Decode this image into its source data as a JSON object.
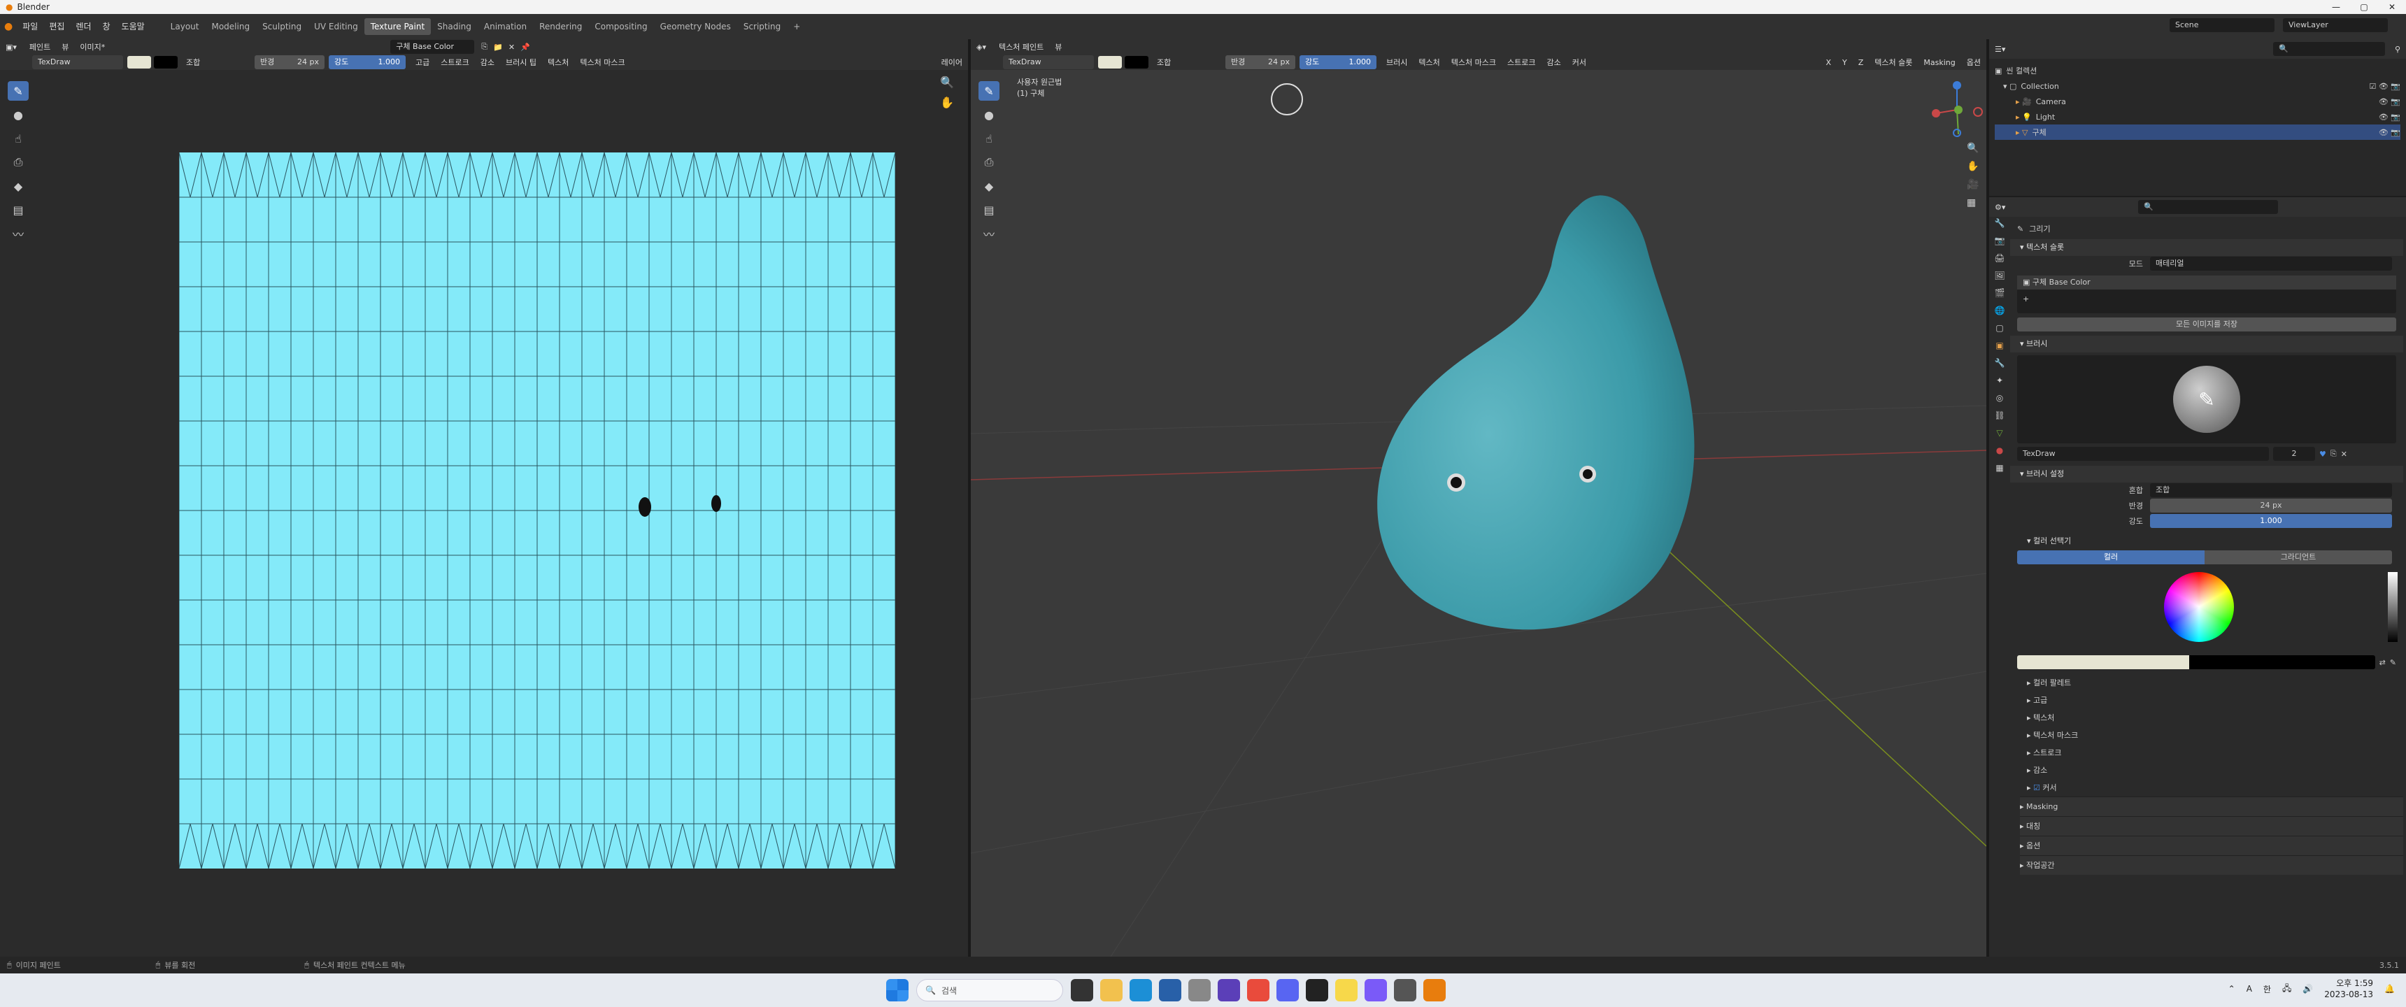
{
  "app": {
    "title": "Blender",
    "version": "3.5.1"
  },
  "menu": [
    "파일",
    "편집",
    "렌더",
    "창",
    "도움말"
  ],
  "workspaces": [
    "Layout",
    "Modeling",
    "Sculpting",
    "UV Editing",
    "Texture Paint",
    "Shading",
    "Animation",
    "Rendering",
    "Compositing",
    "Geometry Nodes",
    "Scripting"
  ],
  "active_workspace": "Texture Paint",
  "scene": {
    "name": "Scene",
    "view_layer": "ViewLayer"
  },
  "image_editor": {
    "mode": "페인트",
    "menus": [
      "뷰",
      "이미지*"
    ],
    "image_name": "구체 Base Color",
    "brush": "TexDraw",
    "blend": "조합",
    "radius_label": "반경",
    "radius_value": "24 px",
    "strength_label": "강도",
    "strength_value": "1.000",
    "dropdowns": [
      "고급",
      "스트로크",
      "감소",
      "브러시 팁",
      "텍스처",
      "텍스처 마스크"
    ],
    "right_label": "레이어"
  },
  "viewport": {
    "mode": "텍스처 페인트",
    "menus": [
      "뷰"
    ],
    "brush": "TexDraw",
    "blend": "조합",
    "radius_label": "반경",
    "radius_value": "24 px",
    "strength_label": "강도",
    "strength_value": "1.000",
    "dropdowns": [
      "브러시",
      "텍스처",
      "텍스처 마스크",
      "스트로크",
      "감소",
      "커서"
    ],
    "right_dropdowns": [
      "텍스처 슬롯",
      "Masking",
      "옵션"
    ],
    "axes": [
      "X",
      "Y",
      "Z"
    ],
    "overlay_line1": "사용자 원근법",
    "overlay_line2": "(1) 구체"
  },
  "outliner": {
    "root": "씬 컬렉션",
    "items": [
      {
        "name": "Collection",
        "selected": false
      },
      {
        "name": "Camera",
        "selected": false
      },
      {
        "name": "Light",
        "selected": false
      },
      {
        "name": "구체",
        "selected": true
      }
    ]
  },
  "properties": {
    "context": "그리기",
    "texture_slots_label": "텍스처 슬롯",
    "mode_label": "모드",
    "mode_value": "매테리얼",
    "slot_item": "구체 Base Color",
    "save_all_images": "모든 이미지를 저장",
    "brush_panel": "브러시",
    "brush_name": "TexDraw",
    "brush_users": "2",
    "brush_settings_panel": "브러시 설정",
    "blend_label": "혼합",
    "blend_value": "조합",
    "radius_label": "반경",
    "radius_value": "24 px",
    "strength_label": "강도",
    "strength_value": "1.000",
    "color_picker_panel": "컬러 선택기",
    "color_tabs": [
      "컬러",
      "그라디언트"
    ],
    "subpanels": [
      "컬러 팔레트",
      "고급",
      "텍스처",
      "텍스처 마스크",
      "스트로크",
      "감소",
      "커서"
    ],
    "bottom_panels": [
      "Masking",
      "대칭",
      "옵션",
      "작업공간"
    ],
    "primary_color": "#e6e5d3",
    "secondary_color": "#000000"
  },
  "status": {
    "left": "이미지 페인트",
    "middle": "뷰를 회전",
    "right": "텍스처 페인트 컨텍스트 메뉴"
  },
  "taskbar": {
    "search_placeholder": "검색",
    "time": "오후 1:59",
    "date": "2023-08-13",
    "tray": [
      "A",
      "한"
    ]
  },
  "colors": {
    "accent_blue": "#4772b3",
    "uv_texture": "#84eaf9",
    "sphere_teal": "#3b9aa8"
  }
}
